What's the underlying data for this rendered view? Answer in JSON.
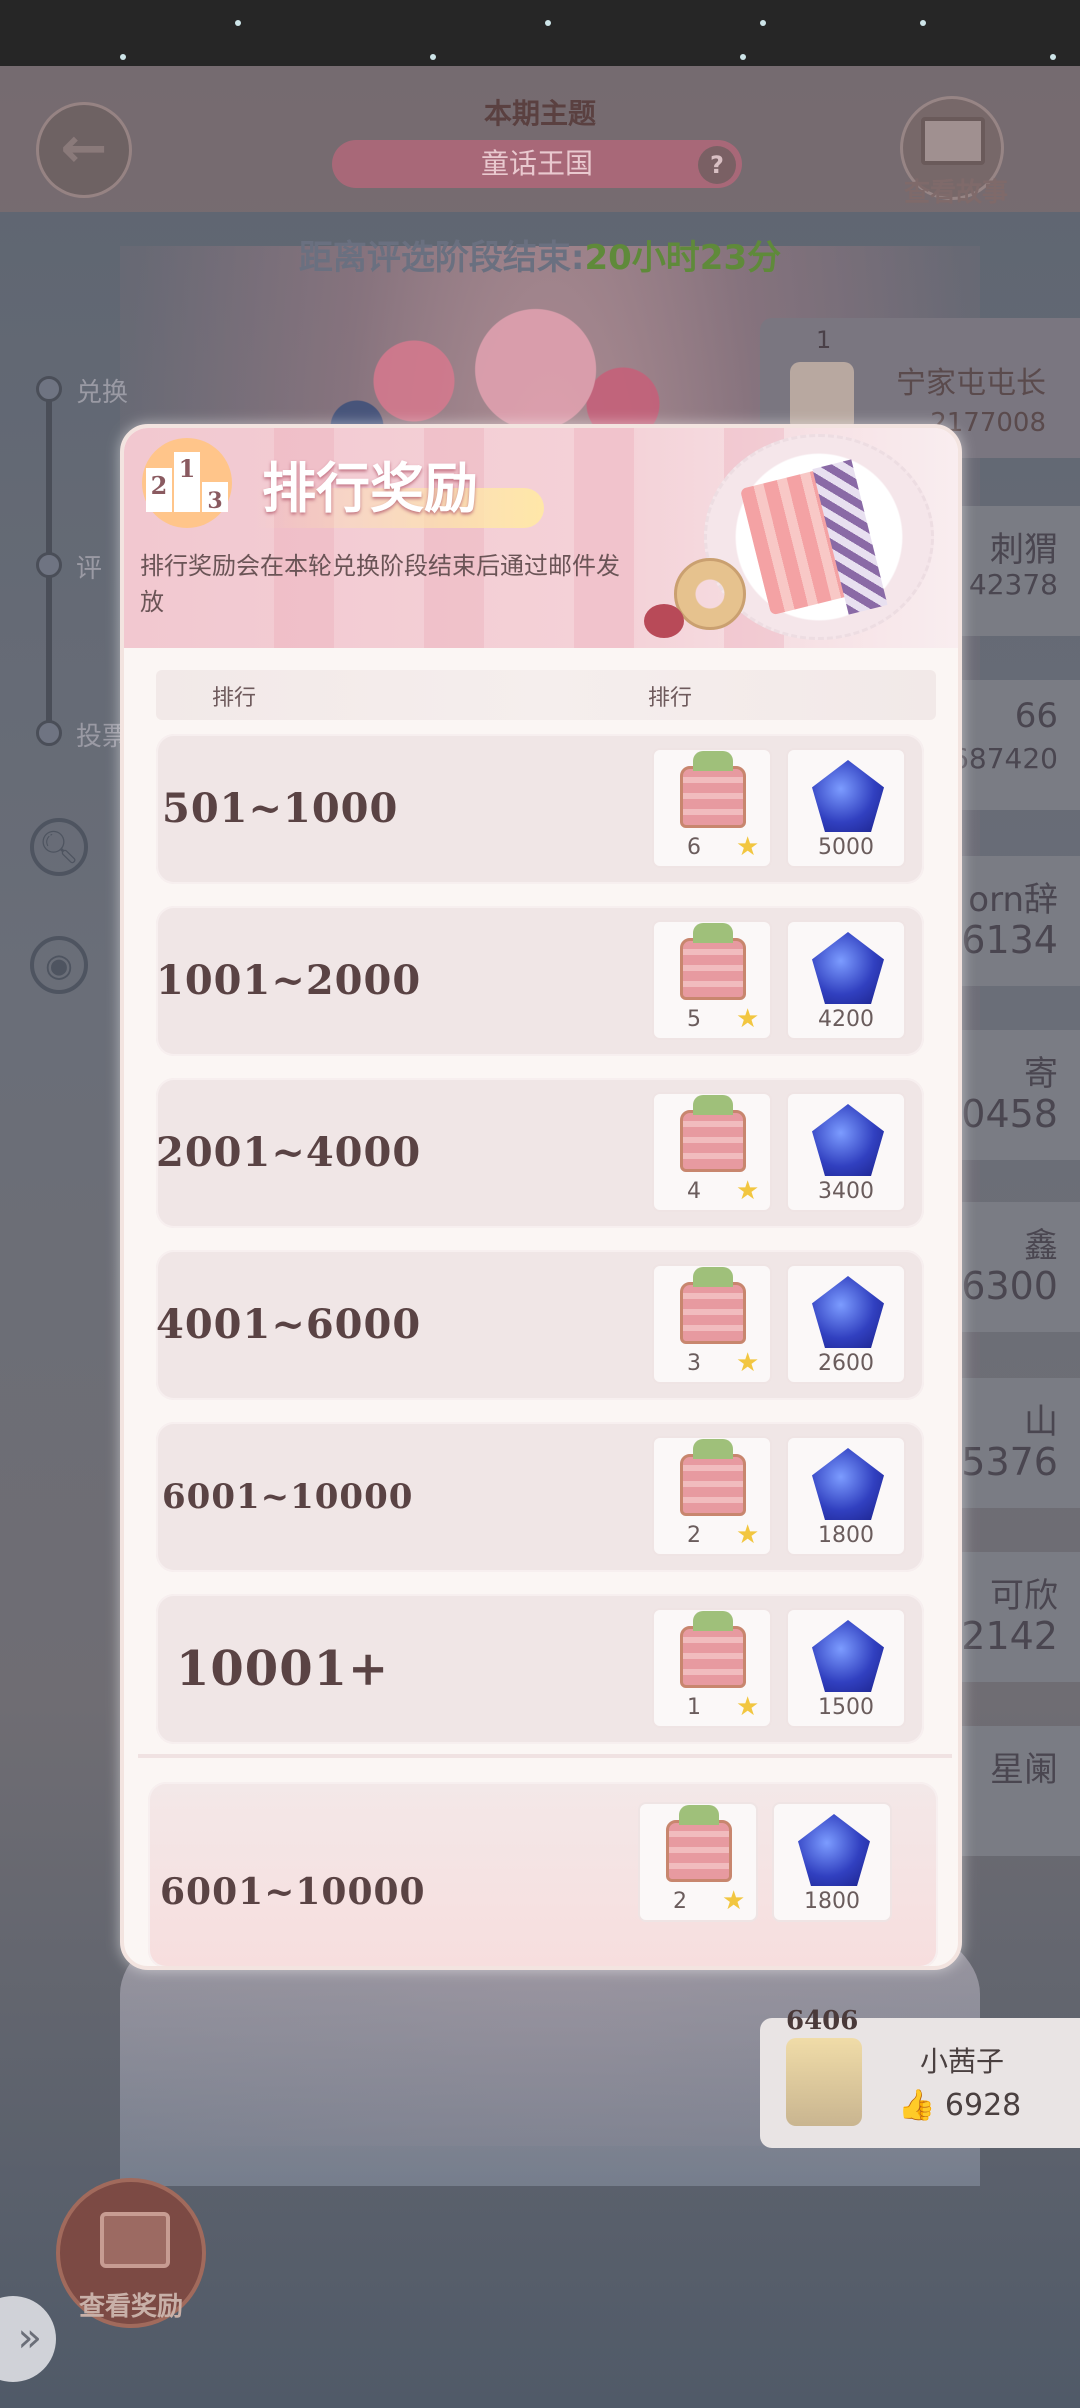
{
  "header": {
    "theme_title": "本期主题",
    "theme_name": "童话王国",
    "help_label": "?",
    "story_label": "查看故事",
    "back_icon": "back-arrow-icon"
  },
  "countdown": {
    "prefix": "距离评选阶段结束:",
    "time": "20小时23分"
  },
  "side": {
    "labels": [
      "兑换",
      "评",
      "投票"
    ]
  },
  "leaderboard": {
    "top": {
      "rank": "1",
      "name": "宁家屯屯长",
      "score": "2177008"
    },
    "entries": [
      {
        "name": "刺猬",
        "score": "42378"
      },
      {
        "name": "66",
        "score": "687420"
      },
      {
        "name": "orn辞",
        "score": "6134"
      },
      {
        "name": "寄",
        "score": "0458"
      },
      {
        "name": "鑫",
        "score": "6300"
      },
      {
        "name": "山",
        "score": "5376"
      },
      {
        "name": "可欣",
        "score": "2142"
      },
      {
        "name": "星阑",
        "score": ""
      }
    ],
    "mine": {
      "rank": "6406",
      "name": "小茜子",
      "likes": "6928",
      "thumb": "👍"
    }
  },
  "bottom": {
    "gift_label": "查看奖励",
    "corner_icon": "»"
  },
  "modal": {
    "title": "排行奖励",
    "description": "排行奖励会在本轮兑换阶段结束后通过邮件发放",
    "podium": [
      "2",
      "1",
      "3"
    ],
    "col_rank": "排行",
    "col_reward": "排行",
    "rows": [
      {
        "range": "501~1000",
        "chest": "6",
        "gems": "5000"
      },
      {
        "range": "1001~2000",
        "chest": "5",
        "gems": "4200"
      },
      {
        "range": "2001~4000",
        "chest": "4",
        "gems": "3400"
      },
      {
        "range": "4001~6000",
        "chest": "3",
        "gems": "2600"
      },
      {
        "range": "6001~10000",
        "chest": "2",
        "gems": "1800"
      },
      {
        "range": "10001+",
        "chest": "1",
        "gems": "1500"
      }
    ],
    "my_row": {
      "range": "6001~10000",
      "chest": "2",
      "gems": "1800"
    },
    "star_glyph": "★"
  }
}
